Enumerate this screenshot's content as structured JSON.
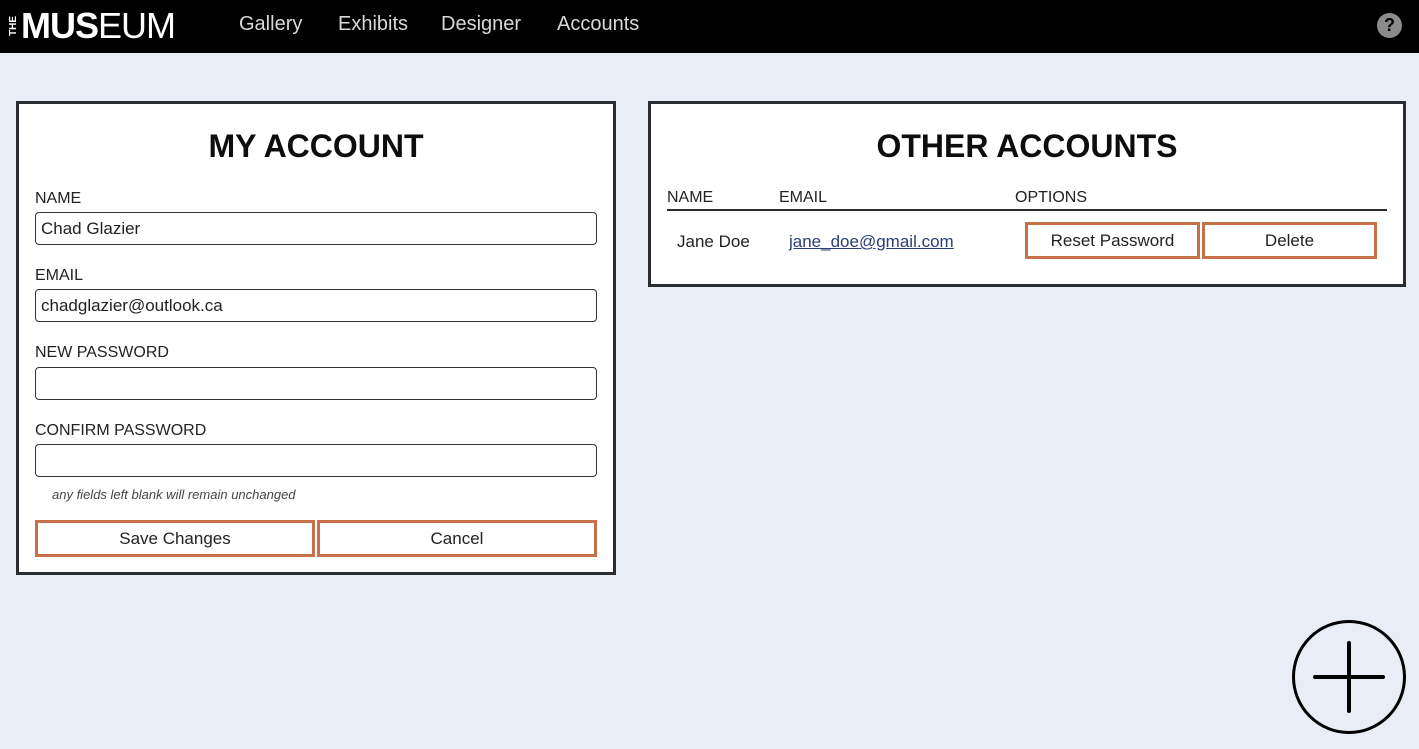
{
  "app": {
    "logo_the": "THE",
    "logo_bold": "MUS",
    "logo_light": "EUM"
  },
  "nav": {
    "items": [
      {
        "label": "Gallery"
      },
      {
        "label": "Exhibits"
      },
      {
        "label": "Designer"
      },
      {
        "label": "Accounts"
      }
    ],
    "help_icon": "help-icon",
    "help_glyph": "?"
  },
  "my_account": {
    "title": "MY ACCOUNT",
    "name_label": "NAME",
    "name_value": "Chad Glazier",
    "email_label": "EMAIL",
    "email_value": "chadglazier@outlook.ca",
    "new_password_label": "NEW PASSWORD",
    "new_password_value": "",
    "confirm_password_label": "CONFIRM PASSWORD",
    "confirm_password_value": "",
    "hint": "any fields left blank will remain unchanged",
    "save_label": "Save Changes",
    "cancel_label": "Cancel"
  },
  "other_accounts": {
    "title": "OTHER ACCOUNTS",
    "columns": [
      "NAME",
      "EMAIL",
      "OPTIONS"
    ],
    "rows": [
      {
        "name": "Jane Doe",
        "email": "jane_doe@gmail.com",
        "reset_label": "Reset Password",
        "delete_label": "Delete"
      }
    ]
  },
  "add_button_icon": "plus-icon",
  "colors": {
    "background": "#e9eef6",
    "topbar": "#000000",
    "button_border": "#c8704a",
    "panel_border": "#2a2d32",
    "link": "#2a3f7a"
  }
}
